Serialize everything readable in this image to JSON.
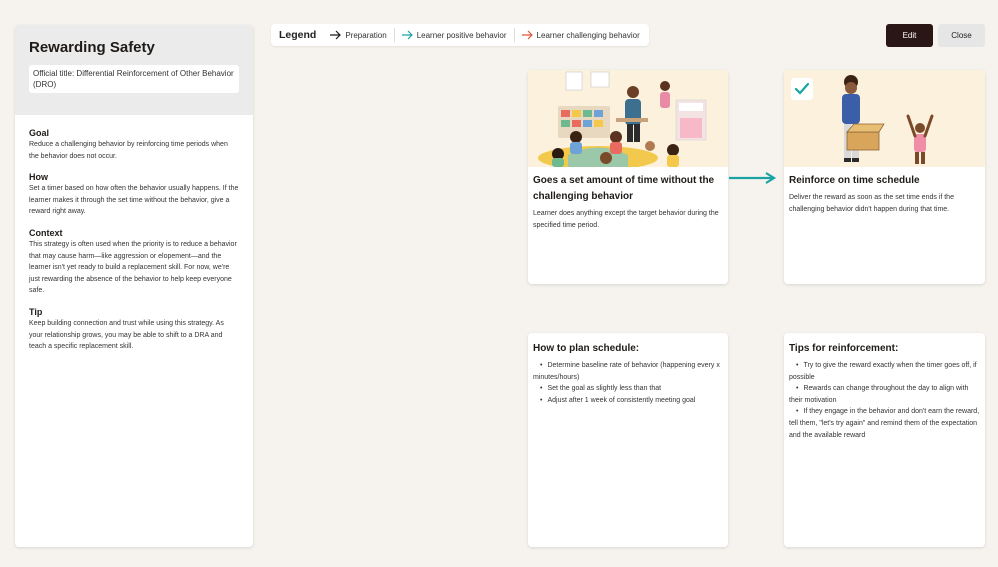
{
  "left_panel": {
    "title": "Rewarding Safety",
    "official_title": "Official title: Differential Reinforcement of Other Behavior (DRO)",
    "sections": [
      {
        "heading": "Goal",
        "text": "Reduce a challenging behavior by reinforcing time periods when the behavior does not occur."
      },
      {
        "heading": "How",
        "text": "Set a timer based on how often the behavior usually happens. If the learner makes it through the set time without the behavior, give a reward right away."
      },
      {
        "heading": "Context",
        "text": "This strategy is often used when the priority is to reduce a behavior that may cause harm—like aggression or elopement—and the learner isn't yet ready to build a replacement skill. For now, we're just rewarding the absence of the behavior to help keep everyone safe."
      },
      {
        "heading": "Tip",
        "text": "Keep building connection and trust while using this strategy. As your relationship grows, you may be able to shift to a DRA and teach a specific replacement skill."
      }
    ]
  },
  "legend": {
    "title": "Legend",
    "items": [
      {
        "label": "Preparation",
        "color": "#1a1a1a"
      },
      {
        "label": "Learner positive behavior",
        "color": "#1aa3a3"
      },
      {
        "label": "Learner challenging behavior",
        "color": "#e0553b"
      }
    ]
  },
  "toolbar": {
    "edit_label": "Edit",
    "close_label": "Close"
  },
  "cards": {
    "step1": {
      "title": "Goes a set amount of time without the challenging behavior",
      "text": "Learner does anything except the target behavior during the specified time period."
    },
    "step2": {
      "title": "Reinforce on time schedule",
      "text": "Deliver the reward as soon as the set time ends if the challenging behavior didn't happen during that time."
    },
    "plan": {
      "title": "How to plan schedule:",
      "items": [
        "Determine baseline rate of behavior (happening every x minutes/hours)",
        "Set the goal as slightly less than that",
        "Adjust after 1 week of consistently meeting goal"
      ]
    },
    "tips": {
      "title": "Tips for reinforcement:",
      "items": [
        "Try to give the reward exactly when the timer goes off, if possible",
        "Rewards can change throughout the day to align with their motivation",
        "If they engage in the behavior and don't earn the reward, tell them, \"let's try again\" and remind them of the expectation and the available reward"
      ]
    }
  },
  "colors": {
    "positive_arrow": "#1aa3a3",
    "check": "#1aa3a3",
    "edit_button": "#2a1615"
  },
  "icons": {
    "step2_badge": "checkmark-icon",
    "flow": "arrow-right-icon"
  }
}
